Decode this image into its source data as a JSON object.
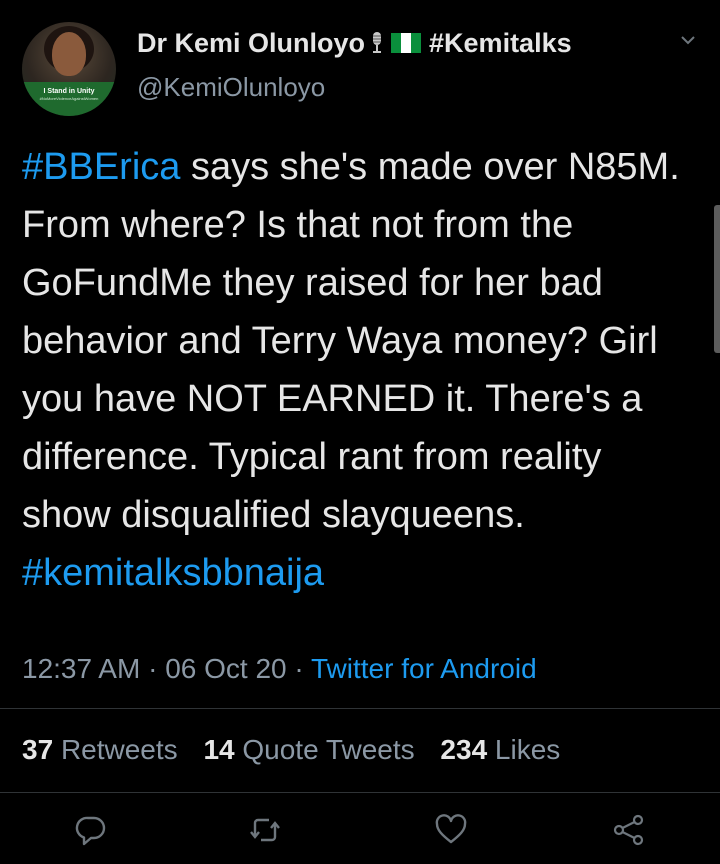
{
  "user": {
    "display_name": "Dr Kemi Olunloyo",
    "flag_emoji": "nigeria-flag",
    "name_suffix": "#Kemitalks",
    "handle": "@KemiOlunloyo",
    "avatar_banner": "I Stand in Unity",
    "avatar_banner_small": "#NoMoreViolenceAgainstWomen"
  },
  "tweet": {
    "hashtag_start": "#BBErica",
    "body": " says she's made over N85M. From where? Is that not from the GoFundMe they raised for her bad behavior and Terry Waya money? Girl you have NOT EARNED it. There's a difference. Typical rant from reality show disqualified slayqueens.",
    "hashtag_end": "#kemitalksbbnaija"
  },
  "meta": {
    "time": "12:37 AM",
    "separator": "·",
    "date": "06 Oct 20",
    "source": "Twitter for Android"
  },
  "stats": {
    "retweets_count": "37",
    "retweets_label": "Retweets",
    "quotes_count": "14",
    "quotes_label": "Quote Tweets",
    "likes_count": "234",
    "likes_label": "Likes"
  },
  "colors": {
    "background": "#000000",
    "text": "#e6e6e6",
    "secondary": "#8b98a5",
    "accent": "#1d9bf0"
  },
  "icons": [
    "microphone-icon",
    "nigeria-flag-icon",
    "chevron-down-icon",
    "reply-icon",
    "retweet-icon",
    "like-icon",
    "share-icon"
  ]
}
